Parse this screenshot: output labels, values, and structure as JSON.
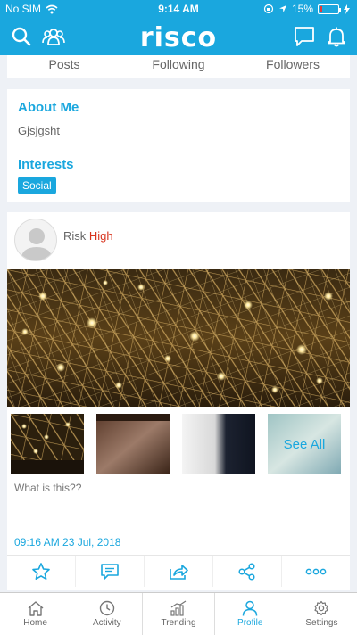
{
  "status_bar": {
    "carrier": "No SIM",
    "time": "9:14 AM",
    "battery_text": "15%",
    "battery_level": 0.15
  },
  "header": {
    "logo": "risco",
    "left_icons": [
      "search-icon",
      "group-icon"
    ],
    "right_icons": [
      "chat-icon",
      "bell-icon"
    ]
  },
  "profile_stats": {
    "posts_label": "Posts",
    "following_label": "Following",
    "followers_label": "Followers"
  },
  "about": {
    "heading": "About Me",
    "bio": "Gjsjgsht",
    "interests_heading": "Interests",
    "interests": [
      "Social"
    ]
  },
  "post": {
    "risk_label": "Risk",
    "risk_level": "High",
    "see_all": "See All",
    "caption": "What is this??",
    "timestamp": "09:16 AM  23 Jul, 2018",
    "actions": [
      "star-icon",
      "comment-icon",
      "share-forward-icon",
      "share-icon",
      "more-icon"
    ]
  },
  "tabbar": {
    "tabs": [
      {
        "label": "Home",
        "icon": "home-icon"
      },
      {
        "label": "Activity",
        "icon": "clock-icon"
      },
      {
        "label": "Trending",
        "icon": "trending-icon"
      },
      {
        "label": "Profile",
        "icon": "profile-icon"
      },
      {
        "label": "Settings",
        "icon": "gear-icon"
      }
    ],
    "active_tab": "Profile"
  },
  "colors": {
    "brand": "#1aa7de",
    "risk_high": "#d8351f",
    "background": "#eef1f6"
  }
}
